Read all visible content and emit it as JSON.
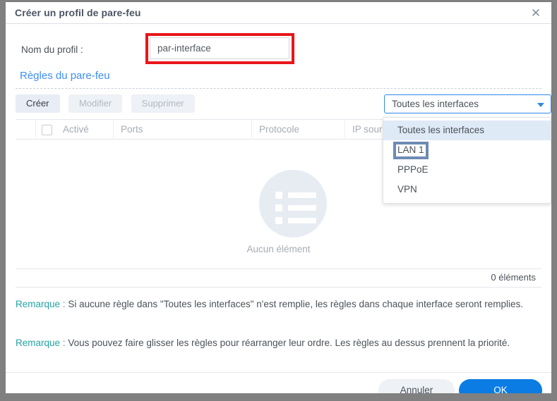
{
  "window": {
    "title": "Créer un profil de pare-feu",
    "close_icon": "close-icon"
  },
  "form": {
    "profile_name_label": "Nom du profil :",
    "profile_name_value": "par-interface",
    "profile_name_placeholder": "",
    "annotation_color": "#e8161a"
  },
  "rules_section": {
    "link_label": "Règles du pare-feu",
    "toolbar": {
      "create_label": "Créer",
      "edit_label": "Modifier",
      "delete_label": "Supprimer"
    },
    "interface_select": {
      "value": "Toutes les interfaces",
      "caret_icon": "chevron-down-icon",
      "options": [
        "Toutes les interfaces",
        "LAN 1",
        "PPPoE",
        "VPN"
      ],
      "selected_index": 0,
      "marked_index": 1,
      "mark_color": "#6d8bb5"
    },
    "table": {
      "columns": [
        "",
        "Activé",
        "Ports",
        "Protocole",
        "IP source"
      ],
      "rows": [],
      "empty_text": "Aucun élément",
      "empty_icon": "list-placeholder-icon",
      "count_text": "0 éléments"
    }
  },
  "notes": [
    {
      "label": "Remarque :",
      "text": "Si aucune règle dans \"Toutes les interfaces\" n'est remplie, les règles dans chaque interface seront remplies."
    },
    {
      "label": "Remarque :",
      "text": "Vous pouvez faire glisser les règles pour réarranger leur ordre. Les règles au dessus prennent la priorité."
    }
  ],
  "footer": {
    "cancel_label": "Annuler",
    "ok_label": "OK",
    "ok_color": "#0a7ce4"
  }
}
